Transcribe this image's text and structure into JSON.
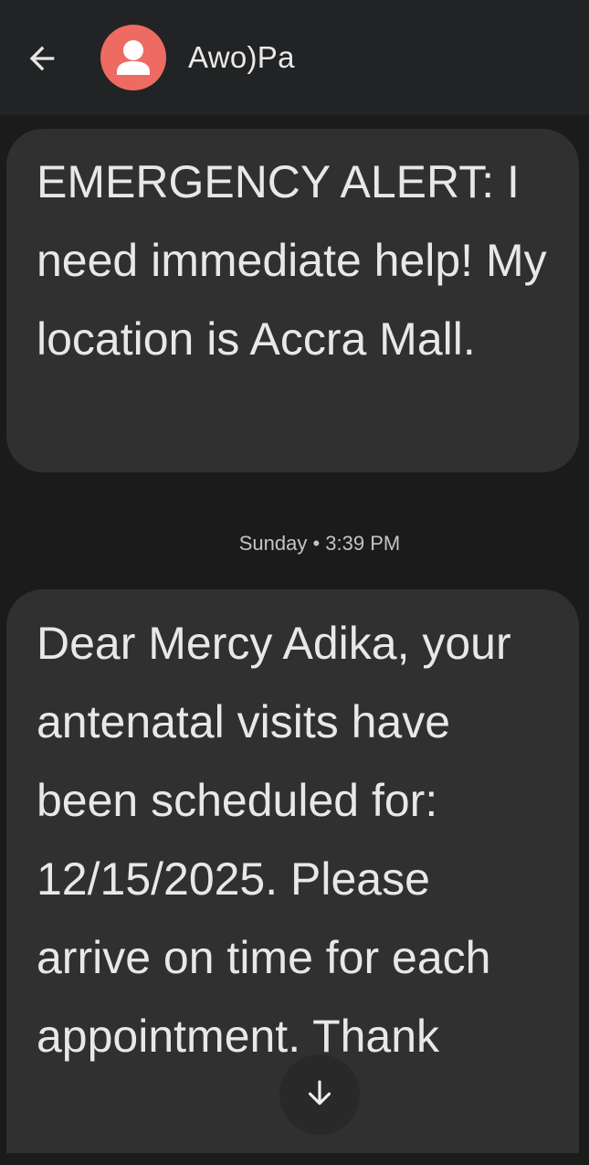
{
  "header": {
    "back_icon": "arrow-left-icon",
    "avatar_icon": "person-icon",
    "avatar_color": "#ed6b63",
    "contact_name": "Awo)Pa"
  },
  "messages": [
    {
      "text": "EMERGENCY ALERT: I need immediate help! My location is Accra Mall."
    },
    {
      "text": "Dear Mercy Adika, your antenatal visits have been scheduled for: 12/15/2025. Please arrive on time for each appointment. Thank"
    }
  ],
  "timestamp": "Sunday • 3:39 PM",
  "scroll_button": {
    "icon": "arrow-down-icon"
  }
}
